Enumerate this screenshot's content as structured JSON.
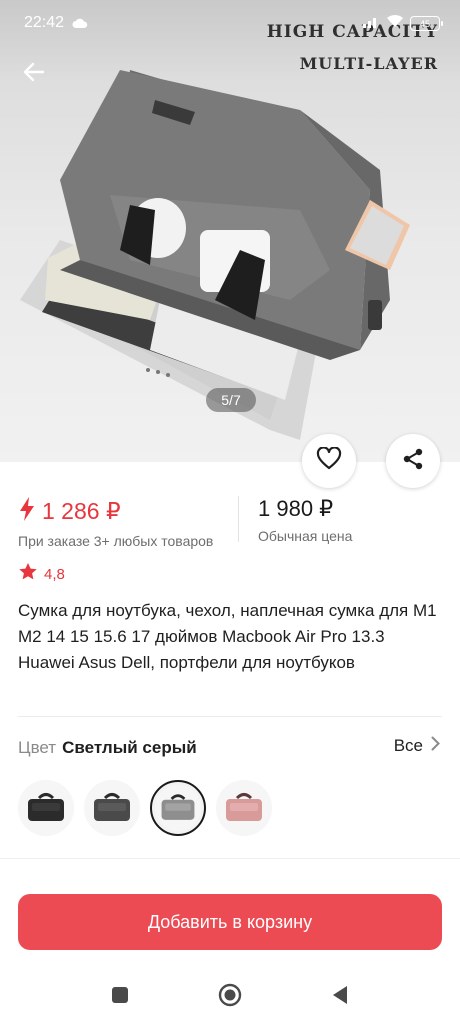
{
  "status": {
    "time": "22:42",
    "battery": "45"
  },
  "hero": {
    "overlay_line1": "HIGH CAPACITY",
    "overlay_line2": "MULTI-LAYER",
    "counter": "5/7"
  },
  "price": {
    "sale_price": "1 286 ₽",
    "sale_note": "При заказе 3+ любых товаров",
    "regular_price": "1 980 ₽",
    "regular_note": "Обычная цена"
  },
  "rating": {
    "value": "4,8"
  },
  "product": {
    "title": "Сумка для ноутбука, чехол, наплечная сумка для M1 M2 14 15 15.6 17 дюймов Macbook Air Pro 13.3 Huawei Asus Dell, портфели для ноутбуков"
  },
  "color": {
    "label": "Цвет",
    "value": "Светлый серый",
    "all_label": "Все"
  },
  "swatches": [
    {
      "name": "black",
      "color": "#2b2b2b"
    },
    {
      "name": "dark-gray",
      "color": "#4a4a4a"
    },
    {
      "name": "light-gray",
      "color": "#8e8e8e"
    },
    {
      "name": "pink",
      "color": "#d99a9a"
    }
  ],
  "actions": {
    "add_to_cart": "Добавить в корзину"
  },
  "colors": {
    "accent": "#e8363e",
    "button": "#ec4b53"
  },
  "icons": {
    "back": "arrow-left-icon",
    "favorite": "heart-icon",
    "share": "share-icon",
    "flash": "lightning-icon",
    "star": "star-icon"
  }
}
